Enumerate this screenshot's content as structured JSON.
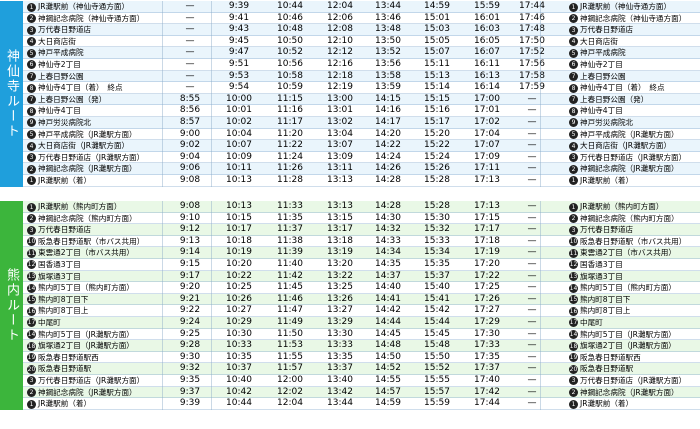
{
  "sections": [
    {
      "label": "神仙寺ルート",
      "color": "#1f9fdc",
      "row_bg_a": "#eaf5fc",
      "row_bg_b": "#ffffff",
      "rows": [
        {
          "n": "1",
          "stop": "JR灘駅前（神仙寺通方面）",
          "times": [
            "—",
            "9:39",
            "10:44",
            "12:04",
            "13:44",
            "14:59",
            "15:59",
            "17:44"
          ],
          "en": "1",
          "end": "JR灘駅前（神仙寺通方面）"
        },
        {
          "n": "2",
          "stop": "神鋼記念病院（神仙寺通方面）",
          "times": [
            "—",
            "9:41",
            "10:46",
            "12:06",
            "13:46",
            "15:01",
            "16:01",
            "17:46"
          ],
          "en": "2",
          "end": "神鋼記念病院（神仙寺通方面）"
        },
        {
          "n": "3",
          "stop": "万代春日野道店",
          "times": [
            "—",
            "9:43",
            "10:48",
            "12:08",
            "13:48",
            "15:03",
            "16:03",
            "17:48"
          ],
          "en": "3",
          "end": "万代春日野道店"
        },
        {
          "n": "4",
          "stop": "大日商店街",
          "times": [
            "—",
            "9:45",
            "10:50",
            "12:10",
            "13:50",
            "15:05",
            "16:05",
            "17:50"
          ],
          "en": "4",
          "end": "大日商店街"
        },
        {
          "n": "5",
          "stop": "神戸平成病院",
          "times": [
            "—",
            "9:47",
            "10:52",
            "12:12",
            "13:52",
            "15:07",
            "16:07",
            "17:52"
          ],
          "en": "5",
          "end": "神戸平成病院"
        },
        {
          "n": "6",
          "stop": "神仙寺2丁目",
          "times": [
            "—",
            "9:51",
            "10:56",
            "12:16",
            "13:56",
            "15:11",
            "16:11",
            "17:56"
          ],
          "en": "6",
          "end": "神仙寺2丁目"
        },
        {
          "n": "7",
          "stop": "上春日野公園",
          "times": [
            "—",
            "9:53",
            "10:58",
            "12:18",
            "13:58",
            "15:13",
            "16:13",
            "17:58"
          ],
          "en": "7",
          "end": "上春日野公園"
        },
        {
          "n": "8",
          "stop": "神仙寺4丁目（着）　終点",
          "times": [
            "—",
            "9:54",
            "10:59",
            "12:19",
            "13:59",
            "15:14",
            "16:14",
            "17:59"
          ],
          "en": "8",
          "end": "神仙寺4丁目（着）　終点"
        },
        {
          "n": "7",
          "stop": "上春日野公園（発）",
          "times": [
            "8:55",
            "10:00",
            "11:15",
            "13:00",
            "14:15",
            "15:15",
            "17:00",
            "—"
          ],
          "en": "7",
          "end": "上春日野公園（発）"
        },
        {
          "n": "8",
          "stop": "神仙寺4丁目",
          "times": [
            "8:56",
            "10:01",
            "11:16",
            "13:01",
            "14:16",
            "15:16",
            "17:01",
            "—"
          ],
          "en": "8",
          "end": "神仙寺4丁目"
        },
        {
          "n": "9",
          "stop": "神戸労災病院北",
          "times": [
            "8:57",
            "10:02",
            "11:17",
            "13:02",
            "14:17",
            "15:17",
            "17:02",
            "—"
          ],
          "en": "9",
          "end": "神戸労災病院北"
        },
        {
          "n": "5",
          "stop": "神戸平成病院（JR灘駅方面）",
          "times": [
            "9:00",
            "10:04",
            "11:20",
            "13:04",
            "14:20",
            "15:20",
            "17:04",
            "—"
          ],
          "en": "5",
          "end": "神戸平成病院（JR灘駅方面）"
        },
        {
          "n": "4",
          "stop": "大日商店街（JR灘駅方面）",
          "times": [
            "9:02",
            "10:07",
            "11:22",
            "13:07",
            "14:22",
            "15:22",
            "17:07",
            "—"
          ],
          "en": "4",
          "end": "大日商店街（JR灘駅方面）"
        },
        {
          "n": "3",
          "stop": "万代春日野道店（JR灘駅方面）",
          "times": [
            "9:04",
            "10:09",
            "11:24",
            "13:09",
            "14:24",
            "15:24",
            "17:09",
            "—"
          ],
          "en": "3",
          "end": "万代春日野道店（JR灘駅方面）"
        },
        {
          "n": "2",
          "stop": "神鋼記念病院（JR灘駅方面）",
          "times": [
            "9:06",
            "10:11",
            "11:26",
            "13:11",
            "14:26",
            "15:26",
            "17:11",
            "—"
          ],
          "en": "2",
          "end": "神鋼記念病院（JR灘駅方面）"
        },
        {
          "n": "1",
          "stop": "JR灘駅前（着）",
          "times": [
            "9:08",
            "10:13",
            "11:28",
            "13:13",
            "14:28",
            "15:28",
            "17:13",
            "—"
          ],
          "en": "1",
          "end": "JR灘駅前（着）"
        }
      ]
    },
    {
      "label": "熊内ルート",
      "color": "#3cb53c",
      "row_bg_a": "#e9f8e6",
      "row_bg_b": "#ffffff",
      "rows": [
        {
          "n": "1",
          "stop": "JR灘駅前（熊内町方面）",
          "times": [
            "9:08",
            "10:13",
            "11:33",
            "13:13",
            "14:28",
            "15:28",
            "17:13",
            "—"
          ],
          "en": "1",
          "end": "JR灘駅前（熊内町方面）"
        },
        {
          "n": "2",
          "stop": "神鋼記念病院（熊内町方面）",
          "times": [
            "9:10",
            "10:15",
            "11:35",
            "13:15",
            "14:30",
            "15:30",
            "17:15",
            "—"
          ],
          "en": "2",
          "end": "神鋼記念病院（熊内町方面）"
        },
        {
          "n": "3",
          "stop": "万代春日野道店",
          "times": [
            "9:12",
            "10:17",
            "11:37",
            "13:17",
            "14:32",
            "15:32",
            "17:17",
            "—"
          ],
          "en": "3",
          "end": "万代春日野道店"
        },
        {
          "n": "10",
          "stop": "阪急春日野道駅（市バス共用）",
          "times": [
            "9:13",
            "10:18",
            "11:38",
            "13:18",
            "14:33",
            "15:33",
            "17:18",
            "—"
          ],
          "en": "10",
          "end": "阪急春日野道駅（市バス共用）"
        },
        {
          "n": "11",
          "stop": "東雲通2丁目（市バス共用）",
          "times": [
            "9:14",
            "10:19",
            "11:39",
            "13:19",
            "14:34",
            "15:34",
            "17:19",
            "—"
          ],
          "en": "11",
          "end": "東雲通2丁目（市バス共用）"
        },
        {
          "n": "12",
          "stop": "国香通3丁目",
          "times": [
            "9:15",
            "10:20",
            "11:40",
            "13:20",
            "14:35",
            "15:35",
            "17:20",
            "—"
          ],
          "en": "12",
          "end": "国香通3丁目"
        },
        {
          "n": "13",
          "stop": "旗塚通3丁目",
          "times": [
            "9:17",
            "10:22",
            "11:42",
            "13:22",
            "14:37",
            "15:37",
            "17:22",
            "—"
          ],
          "en": "13",
          "end": "旗塚通3丁目"
        },
        {
          "n": "14",
          "stop": "熊内町5丁目（熊内町方面）",
          "times": [
            "9:20",
            "10:25",
            "11:45",
            "13:25",
            "14:40",
            "15:40",
            "17:25",
            "—"
          ],
          "en": "14",
          "end": "熊内町5丁目（熊内町方面）"
        },
        {
          "n": "15",
          "stop": "熊内町8丁目下",
          "times": [
            "9:21",
            "10:26",
            "11:46",
            "13:26",
            "14:41",
            "15:41",
            "17:26",
            "—"
          ],
          "en": "15",
          "end": "熊内町8丁目下"
        },
        {
          "n": "16",
          "stop": "熊内町8丁目上",
          "times": [
            "9:22",
            "10:27",
            "11:47",
            "13:27",
            "14:42",
            "15:42",
            "17:27",
            "—"
          ],
          "en": "16",
          "end": "熊内町8丁目上"
        },
        {
          "n": "17",
          "stop": "中尾町",
          "times": [
            "9:24",
            "10:29",
            "11:49",
            "13:29",
            "14:44",
            "15:44",
            "17:29",
            "—"
          ],
          "en": "17",
          "end": "中尾町"
        },
        {
          "n": "14",
          "stop": "熊内町5丁目（JR灘駅方面）",
          "times": [
            "9:25",
            "10:30",
            "11:50",
            "13:30",
            "14:45",
            "15:45",
            "17:30",
            "—"
          ],
          "en": "14",
          "end": "熊内町5丁目（JR灘駅方面）"
        },
        {
          "n": "18",
          "stop": "旗塚通2丁目（JR灘駅方面）",
          "times": [
            "9:28",
            "10:33",
            "11:53",
            "13:33",
            "14:48",
            "15:48",
            "17:33",
            "—"
          ],
          "en": "18",
          "end": "旗塚通2丁目（JR灘駅方面）"
        },
        {
          "n": "19",
          "stop": "阪急春日野道駅西",
          "times": [
            "9:30",
            "10:35",
            "11:55",
            "13:35",
            "14:50",
            "15:50",
            "17:35",
            "—"
          ],
          "en": "19",
          "end": "阪急春日野道駅西"
        },
        {
          "n": "20",
          "stop": "阪急春日野道駅",
          "times": [
            "9:32",
            "10:37",
            "11:57",
            "13:37",
            "14:52",
            "15:52",
            "17:37",
            "—"
          ],
          "en": "20",
          "end": "阪急春日野道駅"
        },
        {
          "n": "3",
          "stop": "万代春日野道店（JR灘駅方面）",
          "times": [
            "9:35",
            "10:40",
            "12:00",
            "13:40",
            "14:55",
            "15:55",
            "17:40",
            "—"
          ],
          "en": "3",
          "end": "万代春日野道店（JR灘駅方面）"
        },
        {
          "n": "2",
          "stop": "神鋼記念病院（JR灘駅方面）",
          "times": [
            "9:37",
            "10:42",
            "12:02",
            "13:42",
            "14:57",
            "15:57",
            "17:42",
            "—"
          ],
          "en": "2",
          "end": "神鋼記念病院（JR灘駅方面）"
        },
        {
          "n": "1",
          "stop": "JR灘駅前（着）",
          "times": [
            "9:39",
            "10:44",
            "12:04",
            "13:44",
            "14:59",
            "15:59",
            "17:44",
            "—"
          ],
          "en": "1",
          "end": "JR灘駅前（着）"
        }
      ]
    }
  ]
}
